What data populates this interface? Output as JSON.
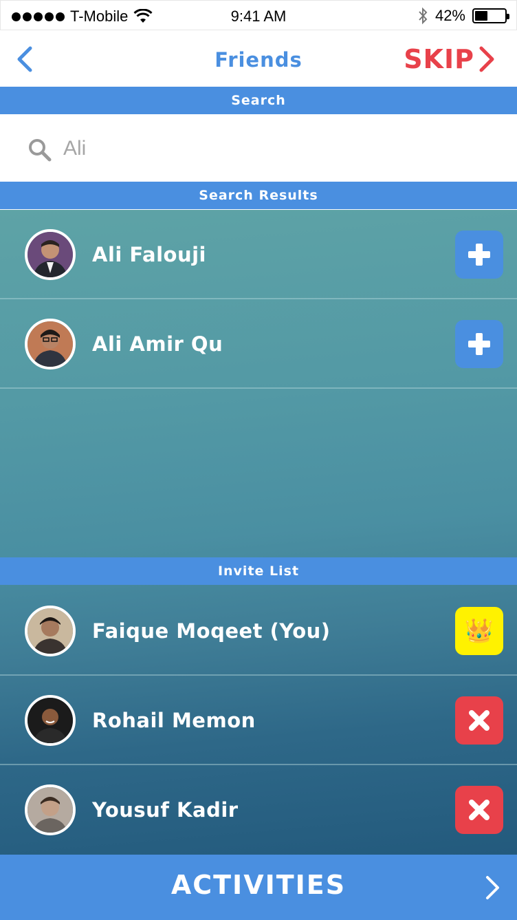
{
  "status_bar": {
    "carrier": "T-Mobile",
    "time": "9:41 AM",
    "battery": "42%",
    "battery_level": 0.42
  },
  "nav": {
    "title": "Friends",
    "skip_label": "SKIP",
    "back_icon": "chevron-left-icon",
    "skip_icon": "chevron-right-icon"
  },
  "search": {
    "section_title": "Search",
    "value": "Ali",
    "icon": "search-icon"
  },
  "results": {
    "section_title": "Search Results",
    "items": [
      {
        "name": "Ali Falouji",
        "action": "add"
      },
      {
        "name": "Ali Amir Qu",
        "action": "add"
      }
    ]
  },
  "invite": {
    "section_title": "Invite List",
    "items": [
      {
        "name": "Faique Moqeet (You)",
        "action": "owner"
      },
      {
        "name": "Rohail Memon",
        "action": "remove"
      },
      {
        "name": "Yousuf Kadir",
        "action": "remove"
      }
    ]
  },
  "bottom": {
    "label": "ACTIVITIES"
  },
  "colors": {
    "accent_blue": "#4a8fe0",
    "skip_red": "#e8414a",
    "remove_red": "#e8414a",
    "crown_yellow": "#fff200",
    "teal_top": "#5ea3a6",
    "teal_bottom": "#235a7d"
  }
}
